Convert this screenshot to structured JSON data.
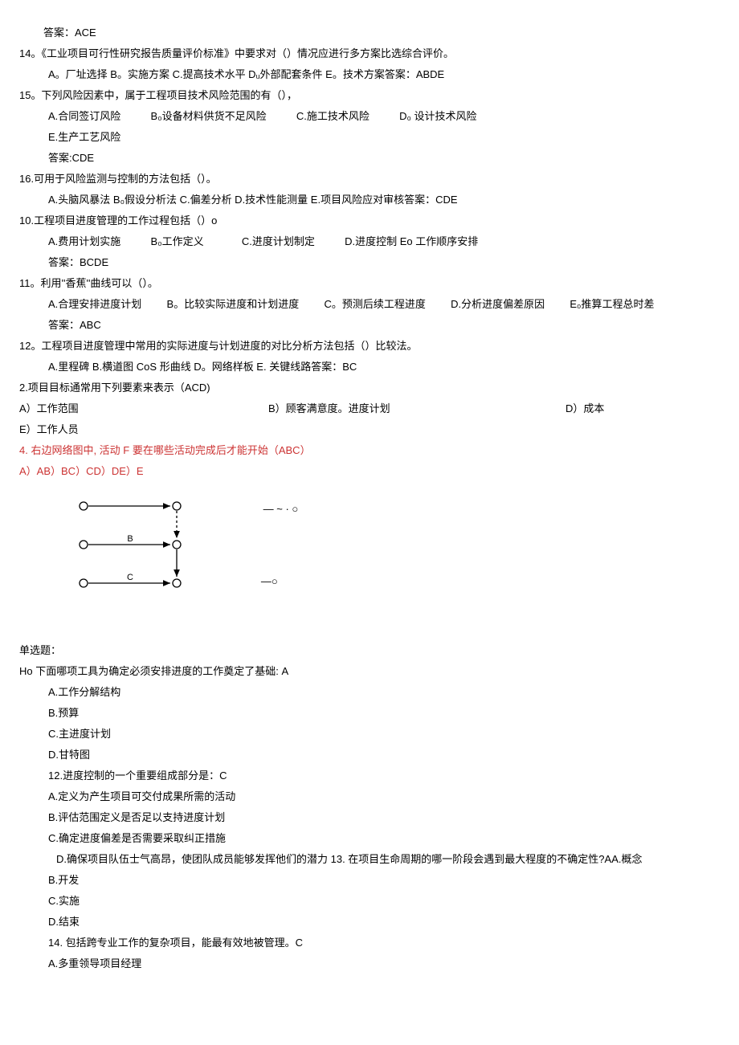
{
  "lines": {
    "l1": "答案：ACE",
    "l2": "14。《工业项目可行性研究报告质量评价标准》中要求对（）情况应进行多方案比选综合评价。",
    "l3": "A。厂址选择 B。实施方案 C.提高技术水平 Dᵤ外部配套条件 E。技术方案答案：ABDE",
    "l4": "15。下列风险因素中，属于工程项目技术风险范围的有（），",
    "l5a": "A.合同签订风险",
    "l5b": "B₀设备材料供货不足风险",
    "l5c": "C.施工技术风险",
    "l5d": "D₀ 设计技术风险",
    "l6": "E.生产工艺风险",
    "l7": "答案:CDE",
    "l8": "16.可用于风险监测与控制的方法包括（）。",
    "l9": "A.头脑风暴法 B₀假设分析法 C.偏差分析 D.技术性能测量 E.项目风险应对审核答案：CDE",
    "l10": "10.工程项目进度管理的工作过程包括（）o",
    "l11a": "A.费用计划实施",
    "l11b": "B₀工作定义",
    "l11c": "C.进度计划制定",
    "l11d": "D.进度控制 Eo 工作顺序安排",
    "l12": "答案：BCDE",
    "l13": "11。利用''香蕉''曲线可以（）。",
    "l14a": "A.合理安排进度计划",
    "l14b": "B。比较实际进度和计划进度",
    "l14c": "C。预测后续工程进度",
    "l14d": "D.分析进度偏差原因",
    "l14e": "E₀推算工程总时差",
    "l15": "答案：ABC",
    "l16": "12。工程项目进度管理中常用的实际进度与计划进度的对比分析方法包括（）比较法。",
    "l17": "A.里程碑 B.横道图 CoS 形曲线 D。网络样板 E. 关键线路答案：BC",
    "l18": "2.项目目标通常用下列要素来表示（ACD)",
    "l19a": "A）工作范围",
    "l19b": "B）顾客满意度。进度计划",
    "l19c": "D）成本",
    "l20": "E）工作人员",
    "l21": "4. 右边网络图中, 活动 F 要在哪些活动完成后才能开始（ABC）",
    "l22": "A）AB）BC）CD）DE）E",
    "d1": "― ~ · ○",
    "d2": "B",
    "d3": "C",
    "d4": "―○",
    "l23": "单选题：",
    "l24": "Ho 下面哪项工具为确定必须安排进度的工作奠定了基础: A",
    "l25": "A.工作分解结构",
    "l26": "B.预算",
    "l27": "C.主进度计划",
    "l28": "D.甘特图",
    "l29": "12.进度控制的一个重要组成部分是：C",
    "l30": "A.定义为产生项目可交付成果所需的活动",
    "l31": "B.评估范围定义是否足以支持进度计划",
    "l32": "C.确定进度偏差是否需要采取纠正措施",
    "l33": "D.确保项目队伍士气高昂，使团队成员能够发挥他们的潜力 13. 在项目生命周期的哪一阶段会遇到最大程度的不确定性?AA.概念",
    "l34": "B.开发",
    "l35": "C.实施",
    "l36": "D.结束",
    "l37": "14. 包括跨专业工作的复杂项目，能最有效地被管理。C",
    "l38": "A.多重领导项目经理"
  }
}
